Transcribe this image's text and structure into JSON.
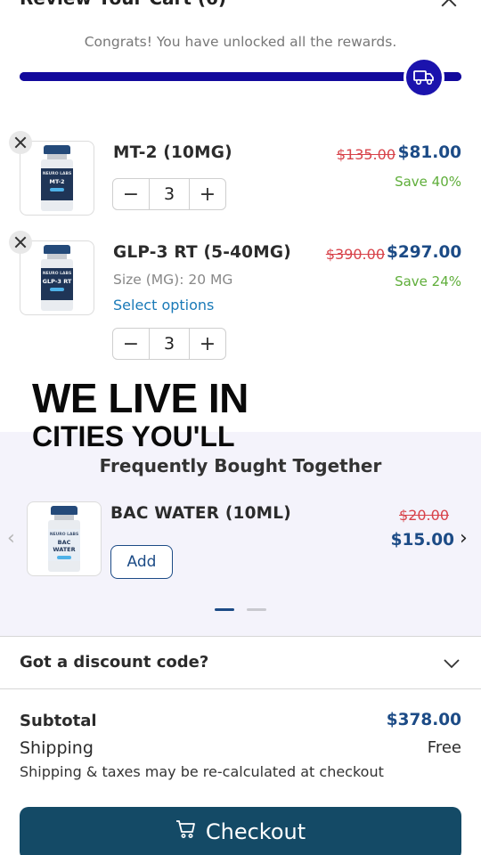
{
  "header": {
    "title": "Review Your Cart (6)"
  },
  "rewards": {
    "message": "Congrats! You have unlocked all the rewards.",
    "progress_percent": 100
  },
  "cart_items": [
    {
      "name": "MT-2 (10MG)",
      "vial_label": "MT-2",
      "vial_brand": "NEURO LABS",
      "old_price": "$135.00",
      "new_price": "$81.00",
      "savings": "Save 40%",
      "quantity": "3"
    },
    {
      "name": "GLP-3 RT (5-40MG)",
      "vial_label": "GLP-3 RT",
      "vial_brand": "NEURO LABS",
      "variant": "Size (MG): 20 MG",
      "select_options": "Select options",
      "old_price": "$390.00",
      "new_price": "$297.00",
      "savings": "Save 24%",
      "quantity": "3"
    }
  ],
  "qty": {
    "minus": "−",
    "plus": "+"
  },
  "overlay": {
    "line1": "WE LIVE IN",
    "line2": "CITIES YOU'LL"
  },
  "fbt": {
    "title": "Frequently Bought Together",
    "item": {
      "name": "BAC WATER (10ML)",
      "vial_label": "BAC WATER",
      "vial_brand": "NEURO LABS",
      "old_price": "$20.00",
      "new_price": "$15.00",
      "add_label": "Add"
    },
    "prev_arrow": "‹",
    "next_arrow": "›"
  },
  "discount": {
    "label": "Got a discount code?"
  },
  "summary": {
    "subtotal_label": "Subtotal",
    "subtotal_value": "$378.00",
    "shipping_label": "Shipping",
    "shipping_value": "Free",
    "note": "Shipping & taxes may be re-calculated at checkout"
  },
  "checkout": {
    "label": "Checkout"
  },
  "colors": {
    "accent": "#1b13ad",
    "price_blue": "#1c4b86",
    "old_price_red": "#d8434a",
    "save_green": "#5fae3a",
    "checkout_bg": "#144a66"
  }
}
